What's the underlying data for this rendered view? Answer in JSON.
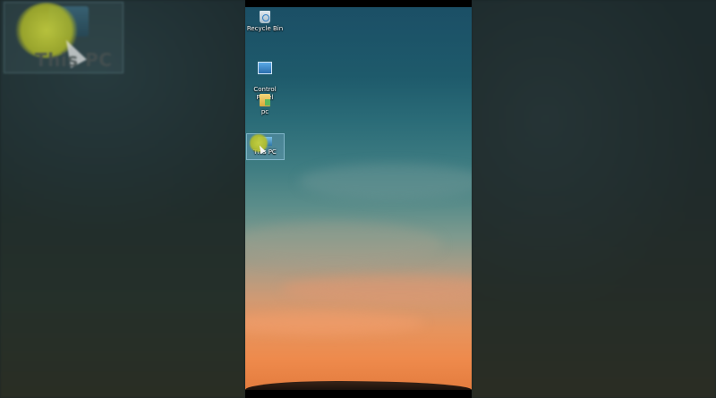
{
  "desktop": {
    "icons": [
      {
        "label": "Recycle Bin",
        "icon": "recycle-bin-icon"
      },
      {
        "label": "Control\nPanel",
        "icon": "control-panel-icon"
      },
      {
        "label": "pc",
        "icon": "folder-icon"
      },
      {
        "label": "This PC",
        "icon": "this-pc-icon"
      }
    ]
  },
  "zoom_preview": {
    "label": "This PC"
  },
  "colors": {
    "sky_top": "#1b4f66",
    "sky_bottom": "#e47c3e",
    "cursor_highlight": "#c8d23c"
  }
}
